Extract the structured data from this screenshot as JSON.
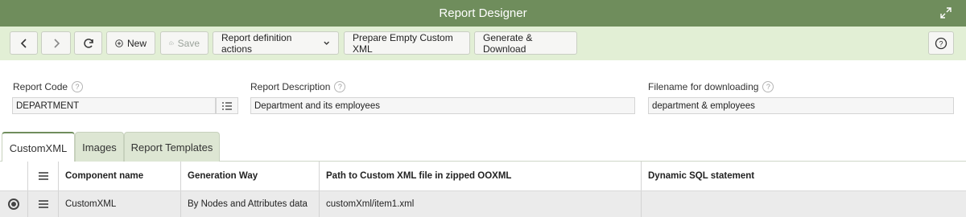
{
  "window": {
    "title": "Report Designer"
  },
  "toolbar": {
    "new_label": "New",
    "save_label": "Save",
    "report_actions_label": "Report definition actions",
    "prepare_label": "Prepare Empty Custom XML",
    "generate_label": "Generate & Download"
  },
  "form": {
    "report_code": {
      "label": "Report Code",
      "value": "DEPARTMENT"
    },
    "report_description": {
      "label": "Report Description",
      "value": "Department and its employees"
    },
    "filename": {
      "label": "Filename for downloading",
      "value": "department & employees"
    }
  },
  "tabs": [
    {
      "label": "CustomXML",
      "active": true
    },
    {
      "label": "Images",
      "active": false
    },
    {
      "label": "Report Templates",
      "active": false
    }
  ],
  "grid": {
    "columns": [
      "Component name",
      "Generation Way",
      "Path to Custom XML file in zipped OOXML",
      "Dynamic SQL statement"
    ],
    "rows": [
      {
        "component": "CustomXML",
        "generation": "By Nodes and Attributes data",
        "path": "customXml/item1.xml",
        "sql": ""
      }
    ]
  },
  "colors": {
    "titlebar": "#6f8d5c",
    "toolbar": "#e2efd5",
    "tab_inactive": "#dde6d3"
  }
}
